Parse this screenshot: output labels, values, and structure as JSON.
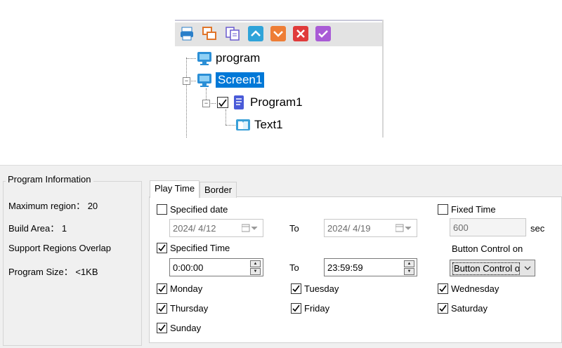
{
  "tree": {
    "toolbar_icons": [
      "print-icon",
      "copy-window-icon",
      "paste-icon",
      "move-up-icon",
      "move-down-icon",
      "delete-icon",
      "confirm-icon"
    ],
    "nodes": [
      {
        "label": "program",
        "icon": "monitor-icon"
      },
      {
        "label": "Screen1",
        "icon": "monitor-icon",
        "selected": true
      },
      {
        "label": "Program1",
        "icon": "document-icon",
        "checked": true
      },
      {
        "label": "Text1",
        "icon": "book-icon"
      }
    ]
  },
  "info": {
    "legend": "Program Information",
    "max_region": "Maximum region： 20",
    "build_area": "Build Area： 1",
    "overlap": "Support Regions Overlap",
    "size": "Program Size： <1KB"
  },
  "tabs": [
    "Play Time",
    "Border"
  ],
  "play_time": {
    "specified_date": {
      "label": "Specified date",
      "checked": false,
      "from": "2024/ 4/12",
      "to_label": "To",
      "to": "2024/ 4/19"
    },
    "specified_time": {
      "label": "Specified Time",
      "checked": true,
      "from": "0:00:00",
      "to_label": "To",
      "to": "23:59:59"
    },
    "fixed_time": {
      "label": "Fixed Time",
      "checked": false,
      "value": "600",
      "unit": "sec"
    },
    "button_control": {
      "label": "Button Control on",
      "selected": "Button Control on"
    },
    "days": [
      {
        "label": "Monday",
        "checked": true
      },
      {
        "label": "Tuesday",
        "checked": true
      },
      {
        "label": "Wednesday",
        "checked": true
      },
      {
        "label": "Thursday",
        "checked": true
      },
      {
        "label": "Friday",
        "checked": true
      },
      {
        "label": "Saturday",
        "checked": true
      },
      {
        "label": "Sunday",
        "checked": true
      }
    ]
  },
  "colors": {
    "selection": "#0078d7",
    "monitor": "#2b8fd6",
    "document": "#4a5bd8"
  }
}
